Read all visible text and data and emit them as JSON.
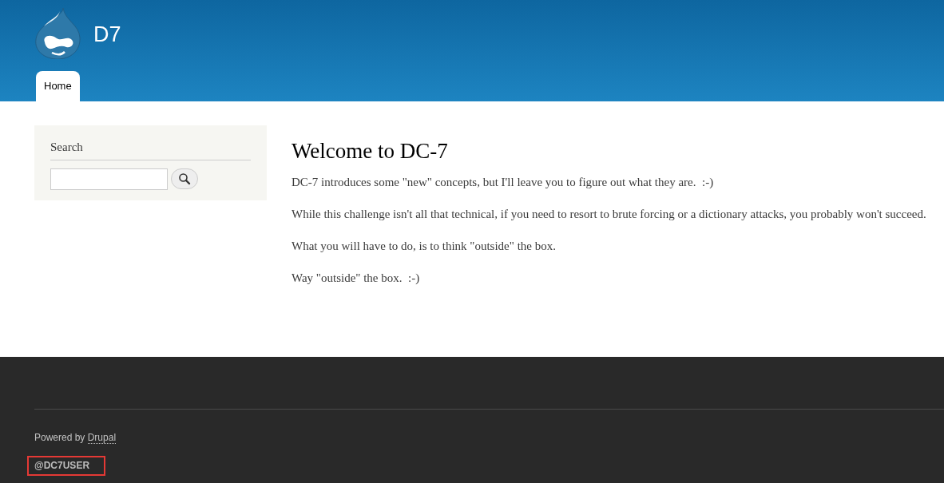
{
  "site": {
    "name": "D7"
  },
  "tabs": [
    {
      "label": "Home",
      "selected": true
    }
  ],
  "sidebar": {
    "block_title": "Search"
  },
  "content": {
    "title": "Welcome to DC-7",
    "paragraphs": [
      "DC-7 introduces some \"new\" concepts, but I'll leave you to figure out what they are.  :-)",
      "While this challenge isn't all that technical, if you need to resort to brute forcing or a dictionary attacks, you probably won't succeed.",
      "What you will have to do, is to think \"outside\" the box.",
      "Way \"outside\" the box.  :-)"
    ]
  },
  "footer": {
    "powered_by": "Powered by",
    "link": "Drupal",
    "handle": "@DC7USER"
  }
}
